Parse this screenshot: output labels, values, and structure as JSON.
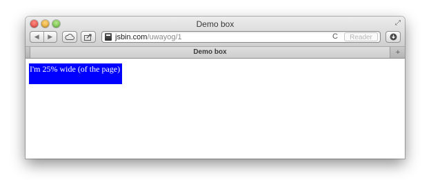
{
  "window": {
    "title": "Demo box"
  },
  "toolbar": {
    "back_icon": "back-arrow-icon",
    "forward_icon": "forward-arrow-icon",
    "icloud_icon": "cloud-icon",
    "share_icon": "share-icon",
    "download_icon": "download-icon",
    "url_host": "jsbin.com",
    "url_path": "/uwayog/1",
    "reload_glyph": "C",
    "reader_label": "Reader"
  },
  "tabs": [
    {
      "label": "Demo box"
    }
  ],
  "content": {
    "box_text": "I'm 25% wide (of the page)",
    "box_color": "#0000ff"
  }
}
